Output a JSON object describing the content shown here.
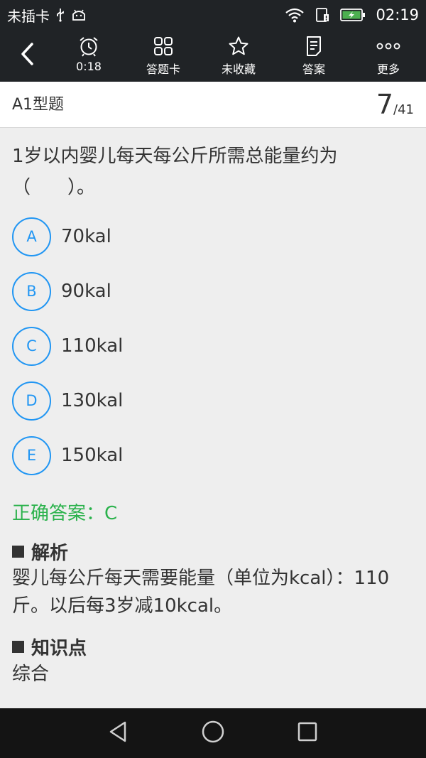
{
  "status_bar": {
    "carrier": "未插卡",
    "time": "02:19"
  },
  "toolbar": {
    "timer_label": "0:18",
    "answer_card_label": "答题卡",
    "favorite_label": "未收藏",
    "answer_label": "答案",
    "more_label": "更多"
  },
  "header": {
    "question_type": "A1型题",
    "current": "7",
    "total": "/41"
  },
  "question": {
    "text": "1岁以内婴儿每天每公斤所需总能量约为（　　）。",
    "options": [
      {
        "letter": "A",
        "text": "70kal"
      },
      {
        "letter": "B",
        "text": "90kal"
      },
      {
        "letter": "C",
        "text": "110kal"
      },
      {
        "letter": "D",
        "text": "130kal"
      },
      {
        "letter": "E",
        "text": "150kal"
      }
    ],
    "correct_answer": "正确答案：C"
  },
  "analysis": {
    "title": "解析",
    "body": "婴儿每公斤每天需要能量（单位为kcal）：110斤。以后每3岁减10kcal。"
  },
  "knowledge": {
    "title": "知识点",
    "body": "综合"
  },
  "colors": {
    "bar_bg": "#202326",
    "accent": "#2196f3",
    "correct": "#2bb24c",
    "battery": "#4caf50"
  }
}
